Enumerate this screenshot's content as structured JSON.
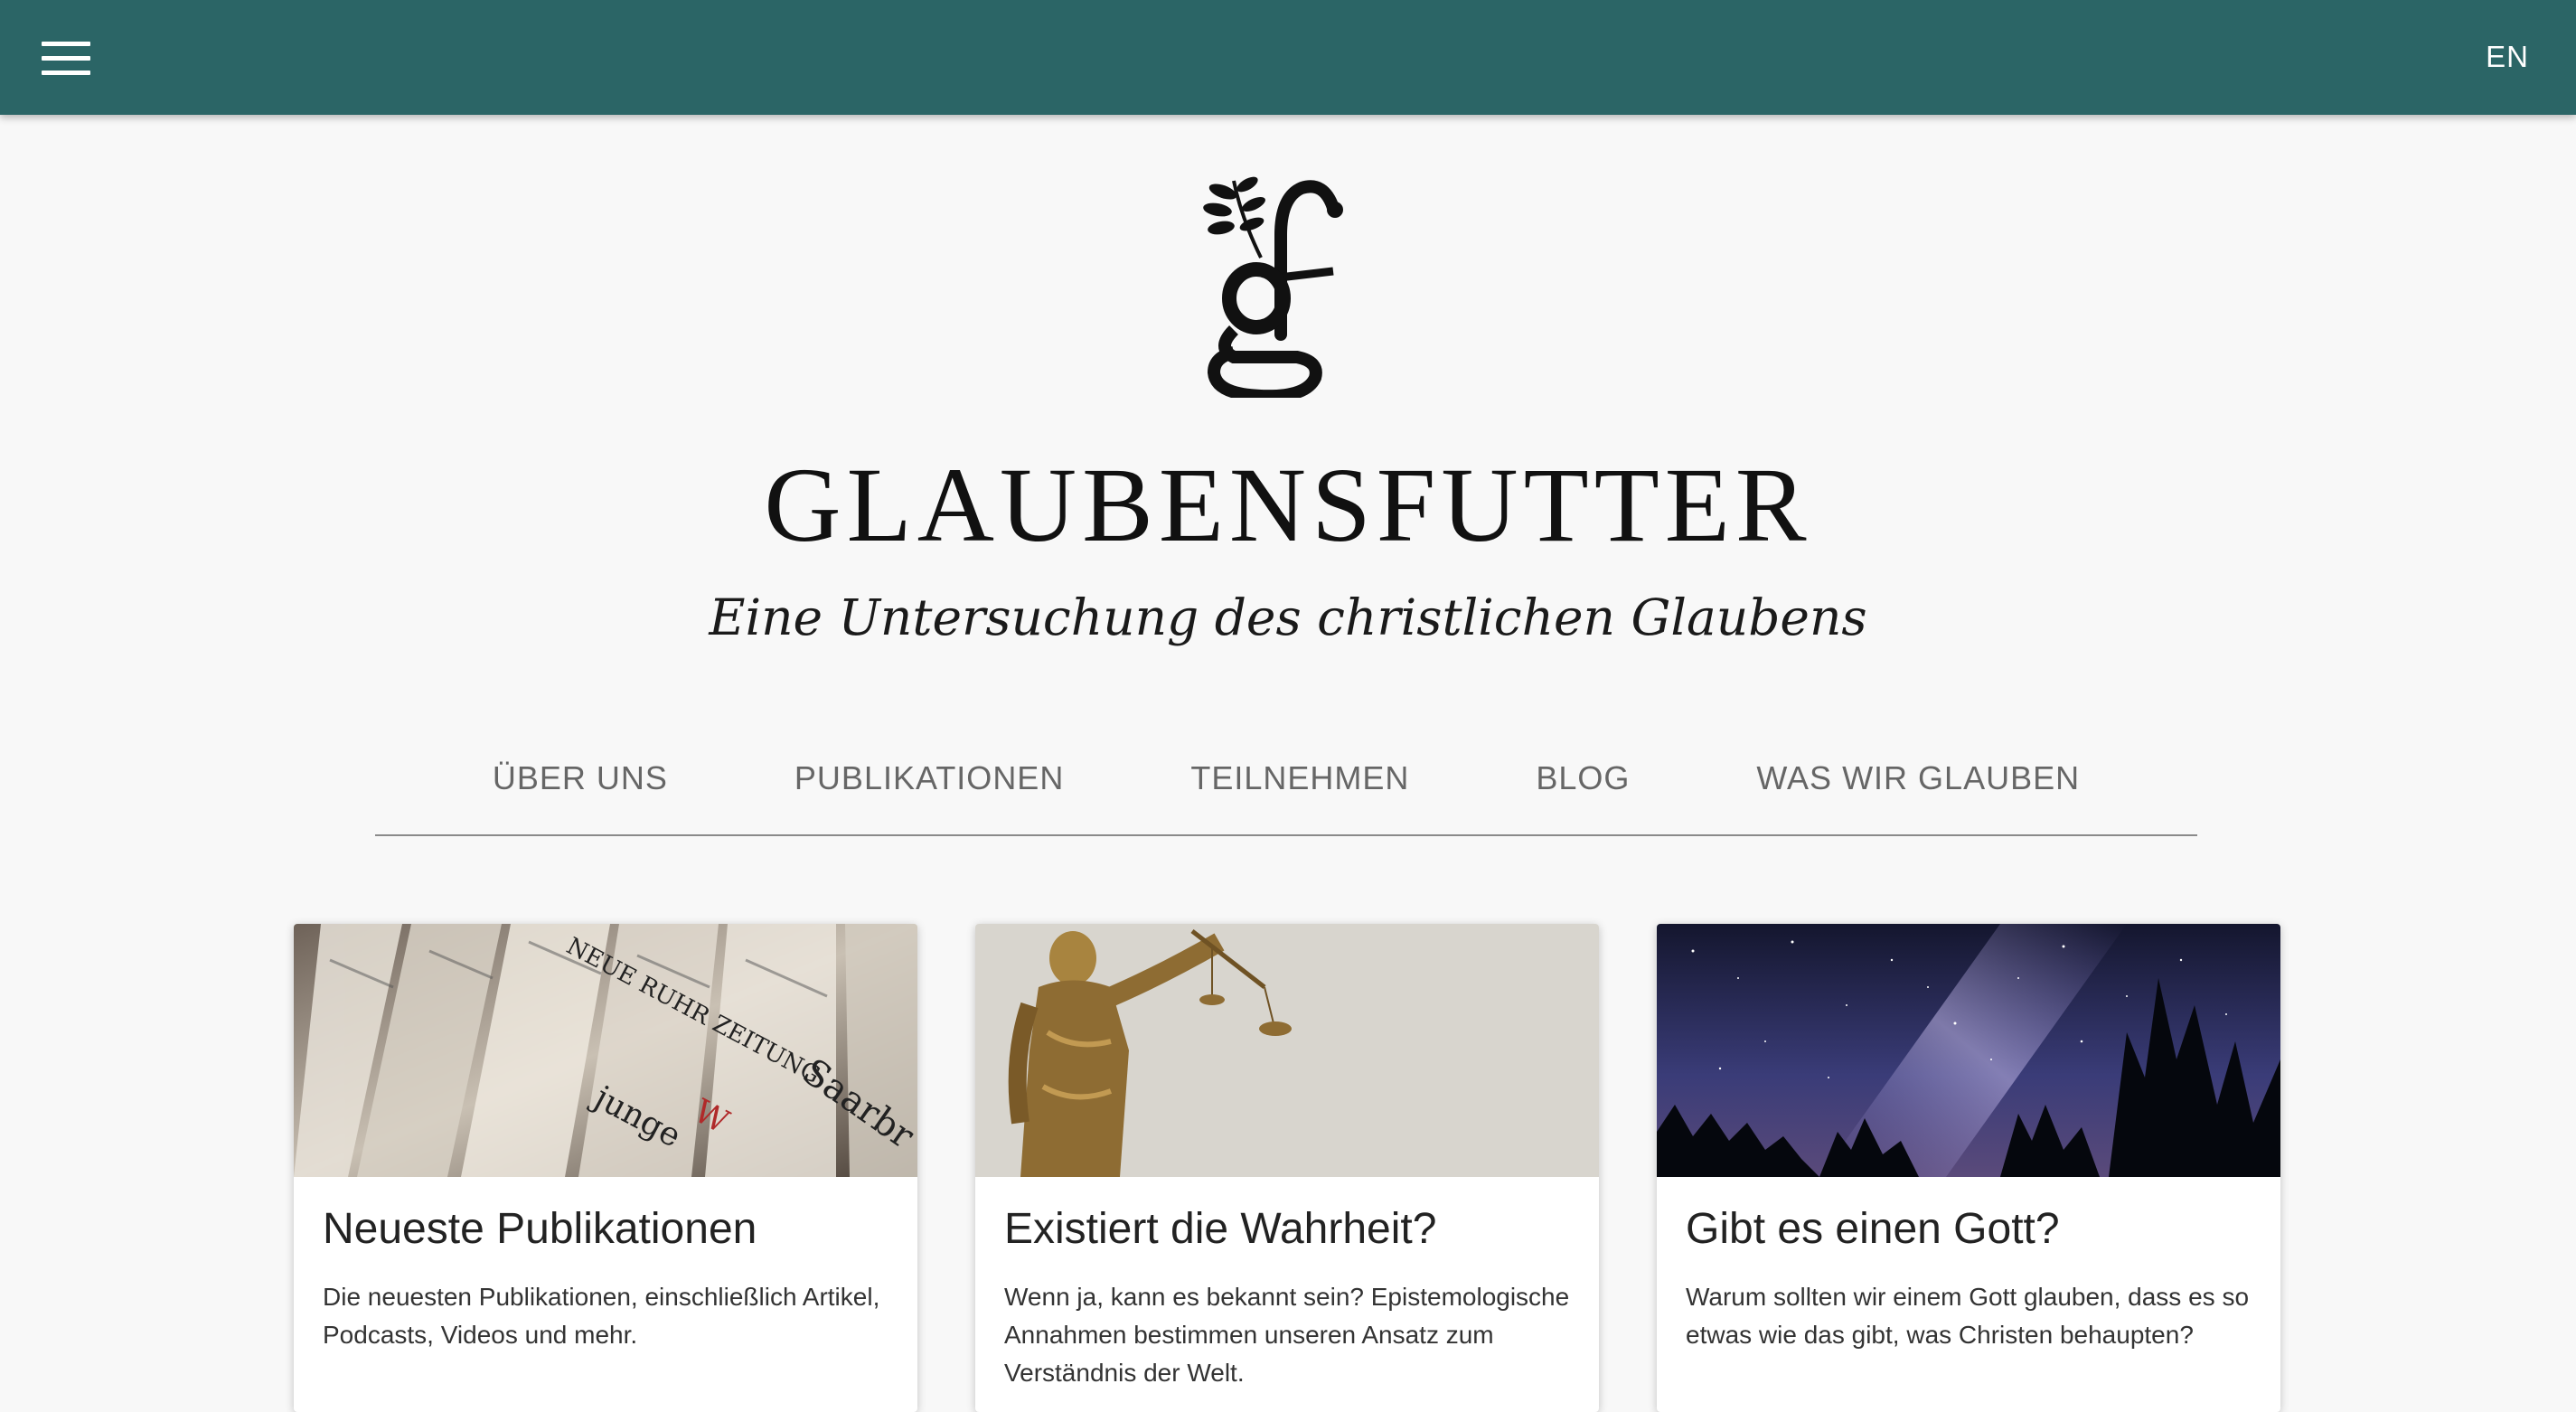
{
  "topbar": {
    "language": "EN",
    "background": "#2b6566"
  },
  "brand": {
    "title": "GLAUBENSFUTTER",
    "tagline": "Eine Untersuchung des christlichen Glaubens"
  },
  "nav": {
    "items": [
      {
        "label": "ÜBER UNS"
      },
      {
        "label": "PUBLIKATIONEN"
      },
      {
        "label": "TEILNEHMEN"
      },
      {
        "label": "BLOG"
      },
      {
        "label": "WAS WIR GLAUBEN"
      }
    ]
  },
  "cards": [
    {
      "title": "Neueste Publikationen",
      "text": "Die neuesten Publikationen, einschließlich Artikel, Podcasts, Videos und mehr.",
      "image": "newspapers-image"
    },
    {
      "title": "Existiert die Wahrheit?",
      "text": "Wenn ja, kann es bekannt sein? Epistemologische Annahmen bestimmen unseren Ansatz zum Verständnis der Welt.",
      "image": "justice-statue-image"
    },
    {
      "title": "Gibt es einen Gott?",
      "text": "Warum sollten wir einem Gott glauben, dass es so etwas wie das gibt, was Christen behaupten?",
      "image": "night-sky-image"
    }
  ]
}
